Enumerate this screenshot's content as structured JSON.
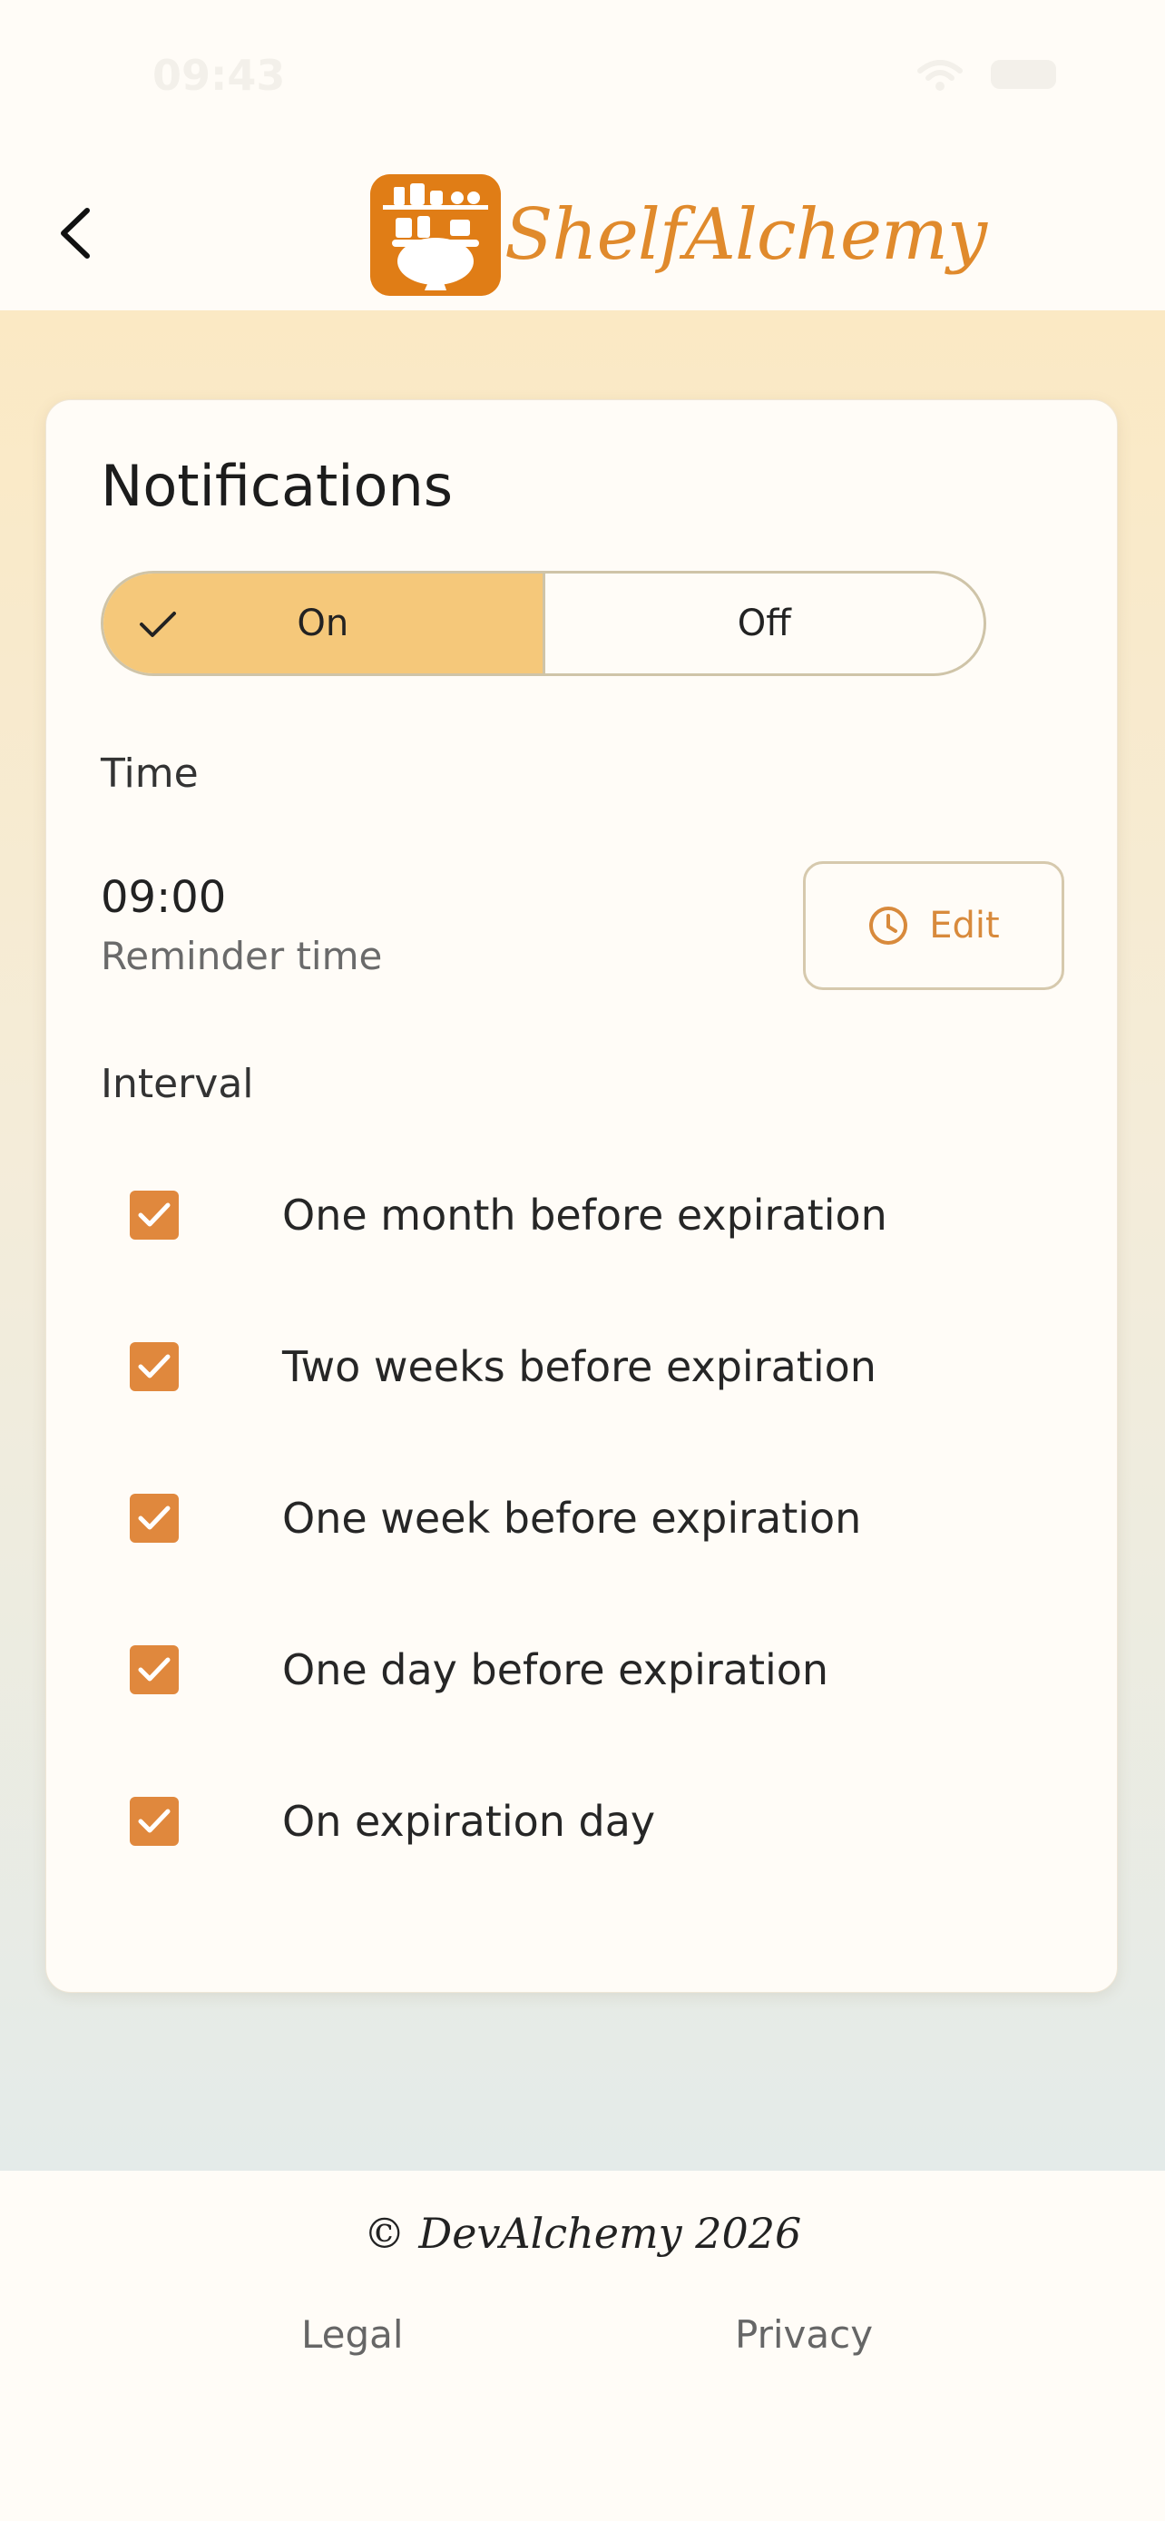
{
  "status_bar": {
    "time": "09:43"
  },
  "header": {
    "app_name": "ShelfAlchemy"
  },
  "notifications": {
    "title": "Notifications",
    "toggle": {
      "on_label": "On",
      "off_label": "Off",
      "selected": "On"
    },
    "time_section_label": "Time",
    "time_value": "09:00",
    "time_caption": "Reminder time",
    "edit_label": "Edit",
    "interval_section_label": "Interval",
    "intervals": [
      {
        "label": "One month before expiration",
        "checked": true
      },
      {
        "label": "Two weeks before expiration",
        "checked": true
      },
      {
        "label": "One week before expiration",
        "checked": true
      },
      {
        "label": "One day before expiration",
        "checked": true
      },
      {
        "label": "On expiration day",
        "checked": true
      }
    ]
  },
  "footer": {
    "copyright": "© DevAlchemy 2026",
    "legal_label": "Legal",
    "privacy_label": "Privacy"
  },
  "colors": {
    "accent": "#e0883d",
    "toggle_on_bg": "#f5c87a",
    "brand": "#e07d16"
  },
  "icons": [
    "wifi-icon",
    "battery-icon",
    "chevron-left-icon",
    "logo-icon",
    "check-icon",
    "clock-icon",
    "checkbox-checked-icon"
  ]
}
